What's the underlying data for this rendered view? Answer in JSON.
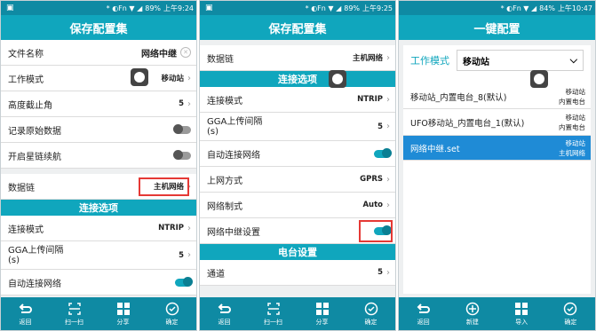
{
  "status_bars": [
    {
      "icons": "* ◐Fn ▼ ◢",
      "battery": "89%",
      "time": "上午9:24"
    },
    {
      "icons": "* ◐Fn ▼ ◢",
      "battery": "89%",
      "time": "上午9:25"
    },
    {
      "icons": "* ◐Fn ▼ ◢",
      "battery": "84%",
      "time": "上午10:47"
    }
  ],
  "panel1": {
    "title": "保存配置集",
    "rows": [
      {
        "label": "文件名称",
        "value": "网络中继"
      },
      {
        "label": "工作模式",
        "value": "移动站"
      },
      {
        "label": "高度截止角",
        "value": "5"
      },
      {
        "label": "记录原始数据",
        "value": ""
      },
      {
        "label": "开启星链续航",
        "value": ""
      },
      {
        "label": "数据链",
        "value": "主机网络"
      }
    ],
    "section": "连接选项",
    "conn_rows": [
      {
        "label": "连接模式",
        "value": "NTRIP"
      },
      {
        "label": "GGA上传间隔\n(s)",
        "value": "5"
      },
      {
        "label": "自动连接网络",
        "value": ""
      }
    ]
  },
  "panel2": {
    "title": "保存配置集",
    "rows": [
      {
        "label": "数据链",
        "value": "主机网络"
      }
    ],
    "section": "连接选项",
    "conn_rows": [
      {
        "label": "连接模式",
        "value": "NTRIP"
      },
      {
        "label": "GGA上传间隔\n(s)",
        "value": "5"
      },
      {
        "label": "自动连接网络",
        "value": ""
      },
      {
        "label": "上网方式",
        "value": "GPRS"
      },
      {
        "label": "网络制式",
        "value": "Auto"
      },
      {
        "label": "网络中继设置",
        "value": ""
      }
    ],
    "section2": "电台设置",
    "radio_rows": [
      {
        "label": "通道",
        "value": "5"
      }
    ]
  },
  "panel3": {
    "title": "一键配置",
    "mode_label": "工作模式",
    "mode_value": "移动站",
    "items": [
      {
        "name": "移动站_内置电台_8(默认)",
        "side1": "移动站",
        "side2": "内置电台"
      },
      {
        "name": "UFO移动站_内置电台_1(默认)",
        "side1": "移动站",
        "side2": "内置电台"
      },
      {
        "name": "网络中继.set",
        "side1": "移动站",
        "side2": "主机网络"
      }
    ]
  },
  "bottom": {
    "p1": [
      "返回",
      "扫一扫",
      "分享",
      "确定"
    ],
    "p2": [
      "返回",
      "扫一扫",
      "分享",
      "确定"
    ],
    "p3": [
      "返回",
      "新建",
      "导入",
      "确定"
    ]
  }
}
